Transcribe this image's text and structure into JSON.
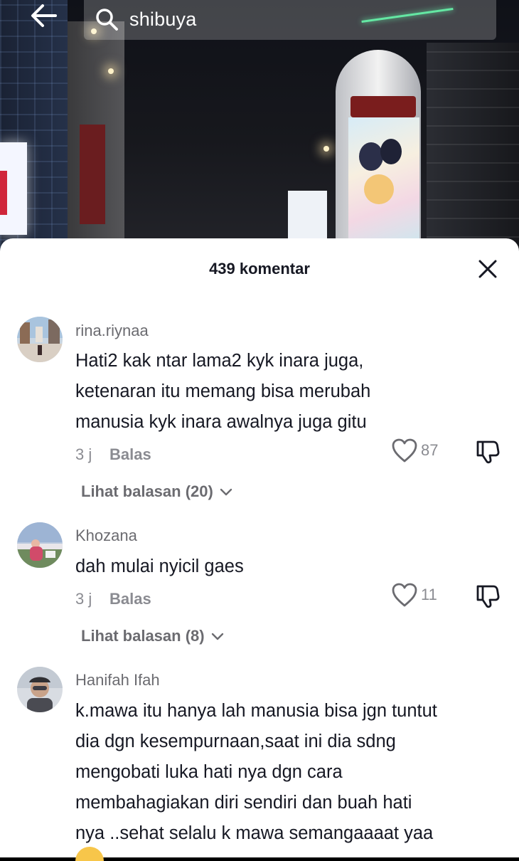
{
  "search": {
    "query": "shibuya"
  },
  "sheet": {
    "title": "439 komentar"
  },
  "comments": [
    {
      "username": "rina.riynaa",
      "lines": [
        "Hati2 kak ntar lama2 kyk inara juga,",
        "ketenaran itu memang bisa merubah",
        "manusia kyk inara awalnya juga gitu"
      ],
      "time": "3 j",
      "reply_label": "Balas",
      "likes": "87",
      "view_replies": "Lihat balasan (20)"
    },
    {
      "username": "Khozana",
      "lines": [
        "dah mulai nyicil gaes"
      ],
      "time": "3 j",
      "reply_label": "Balas",
      "likes": "11",
      "view_replies": "Lihat balasan (8)"
    },
    {
      "username": "Hanifah Ifah",
      "lines": [
        "k.mawa itu hanya lah manusia bisa jgn tuntut",
        "dia dgn kesempurnaan,saat ini dia sdng",
        "mengobati luka hati nya dgn cara",
        "membahagiakan diri sendiri dan buah hati",
        "nya ..sehat selalu k mawa semangaaaat yaa"
      ]
    }
  ],
  "colors": {
    "text_primary": "#161823",
    "text_secondary": "#8a8b91",
    "sheet_bg": "#ffffff"
  },
  "icons": [
    "back-arrow-icon",
    "search-icon",
    "close-icon",
    "heart-icon",
    "dislike-icon",
    "chevron-down-icon"
  ]
}
